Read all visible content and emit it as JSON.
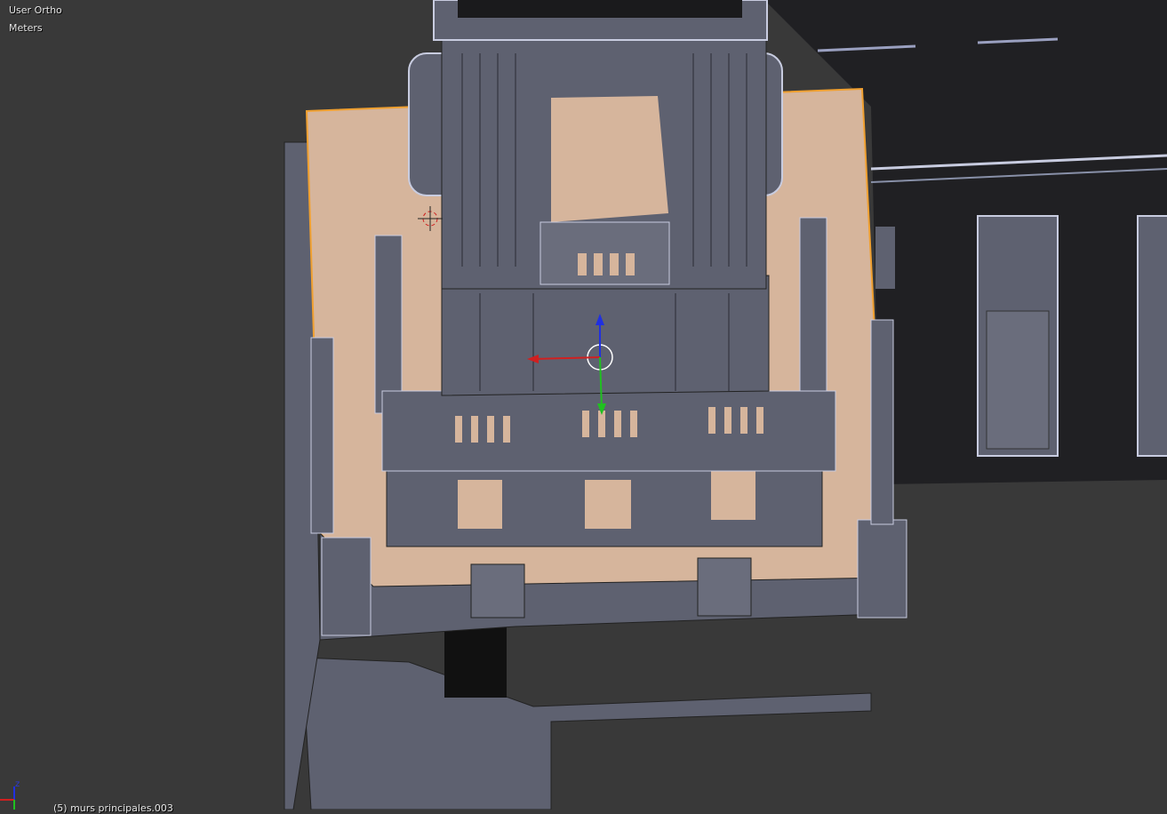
{
  "viewport": {
    "view_name": "User Ortho",
    "units": "Meters",
    "active_object": "(5) murs principales.003",
    "axis_label_z": "z"
  },
  "colors": {
    "background": "#393939",
    "mesh": "#5e6170",
    "floor": "#d6b59c",
    "selection_outline": "#f0a030",
    "building": "#1f1f22",
    "gizmo_x": "#d02020",
    "gizmo_y": "#20c020",
    "gizmo_z": "#2030e0"
  }
}
